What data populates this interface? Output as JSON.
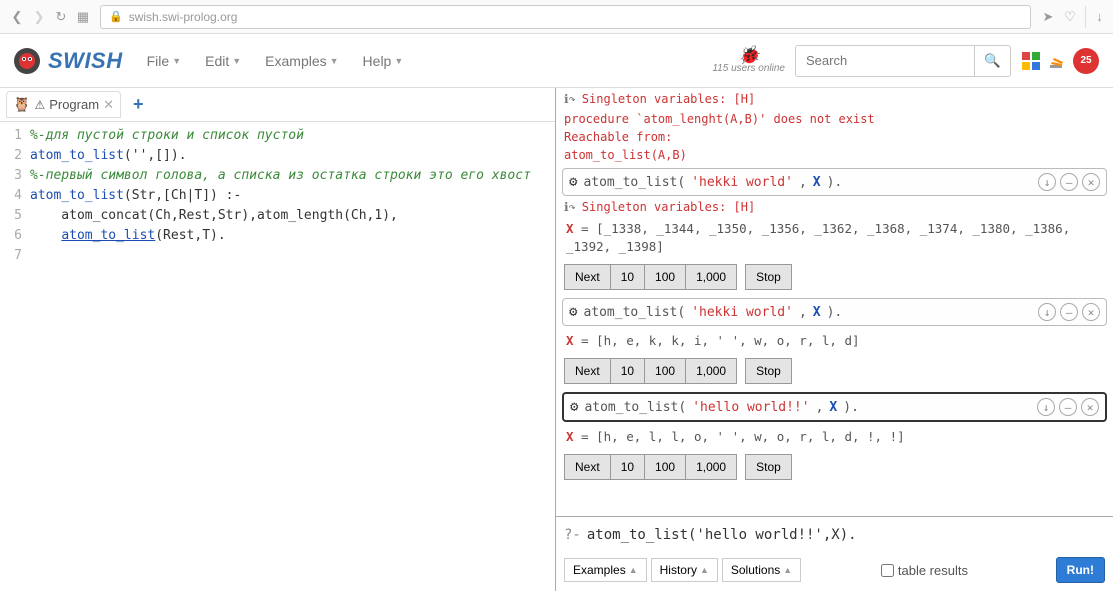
{
  "browser": {
    "url": "swish.swi-prolog.org"
  },
  "app": {
    "title": "SWISH",
    "menus": [
      "File",
      "Edit",
      "Examples",
      "Help"
    ],
    "users_online": "115 users online",
    "search_placeholder": "Search",
    "notif_count": "25"
  },
  "tab": {
    "label": "Program"
  },
  "code": {
    "lines": [
      {
        "type": "comment",
        "text": "%-для пустой строки и список пустой"
      },
      {
        "type": "fact",
        "func": "atom_to_list",
        "args": "('',[])."
      },
      {
        "type": "comment",
        "text": "%-первый символ голова, а списка из остатка строки это его хвост"
      },
      {
        "type": "rule_head",
        "func": "atom_to_list",
        "args": "(Str,[Ch|T]) :-"
      },
      {
        "type": "rule_body",
        "text": "    atom_concat(Ch,Rest,Str),atom_length(Ch,1),"
      },
      {
        "type": "rule_body_u",
        "func": "atom_to_list",
        "args": "(Rest,T)."
      },
      {
        "type": "empty",
        "text": ""
      }
    ]
  },
  "results": {
    "top_warn": "Singleton variables: [H]",
    "error": {
      "l1": "procedure `atom_lenght(A,B)' does not exist",
      "l2": "Reachable from:",
      "l3": "          atom_to_list(A,B)"
    },
    "runs": [
      {
        "query_func": "atom_to_list",
        "query_str": "'hekki world'",
        "query_var": "X",
        "warn": "Singleton variables: [H]",
        "result": "X = [_1338, _1344, _1350, _1356, _1362, _1368, _1374, _1380, _1386, _1392, _1398]",
        "selected": false
      },
      {
        "query_func": "atom_to_list",
        "query_str": "'hekki world'",
        "query_var": "X",
        "result": "X = [h, e, k, k, i, ' ', w, o, r, l, d]",
        "selected": false
      },
      {
        "query_func": "atom_to_list",
        "query_str": "'hello world!!'",
        "query_var": "X",
        "result": "X = [h, e, l, l, o, ' ', w, o, r, l, d, !, !]",
        "selected": true
      }
    ],
    "next_buttons": [
      "Next",
      "10",
      "100",
      "1,000"
    ],
    "stop": "Stop"
  },
  "query_input": {
    "prompt": "?-",
    "text": "atom_to_list('hello world!!',X).",
    "bottom_buttons": [
      "Examples",
      "History",
      "Solutions"
    ],
    "table_results": "table results",
    "run": "Run!"
  }
}
